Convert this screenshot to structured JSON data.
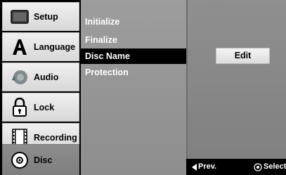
{
  "sidebar": {
    "items": [
      {
        "label": "Setup",
        "icon": "tv-screen-icon"
      },
      {
        "label": "Language",
        "icon": "letter-a-icon"
      },
      {
        "label": "Audio",
        "icon": "speaker-icon"
      },
      {
        "label": "Lock",
        "icon": "padlock-icon"
      },
      {
        "label": "Recording",
        "icon": "film-strip-icon"
      },
      {
        "label": "Disc",
        "icon": "disc-icon",
        "active": true
      }
    ]
  },
  "menu": {
    "items": [
      "Initialize",
      "Finalize",
      "Disc Name",
      "Protection"
    ],
    "selected": "Disc Name"
  },
  "panel": {
    "edit_label": "Edit"
  },
  "footer": {
    "prev_label": "Prev.",
    "select_label": "Select"
  },
  "colors": {
    "menu_bg": "#939393",
    "selected_bg": "#000000",
    "button_bg": "#e8e8e8"
  }
}
